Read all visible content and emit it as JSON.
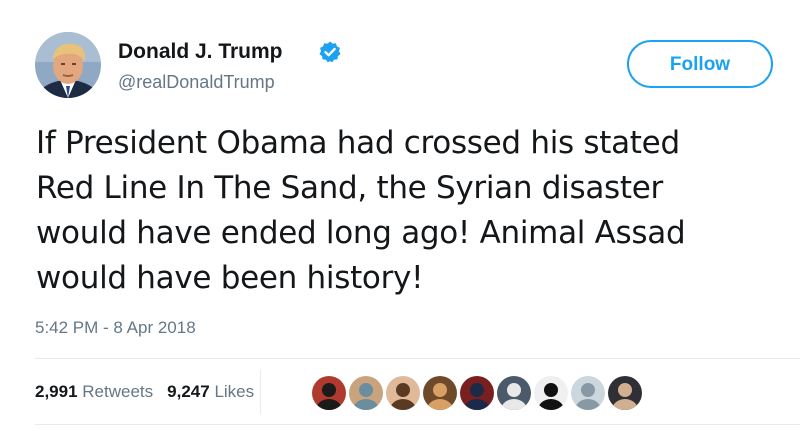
{
  "author": {
    "display_name": "Donald J. Trump",
    "handle": "@realDonaldTrump",
    "verified": true,
    "avatar_icon": "profile-photo"
  },
  "follow_button": {
    "label": "Follow",
    "color": "#1da1f2"
  },
  "tweet": {
    "lines": [
      "If President Obama had crossed his stated",
      "Red Line In The Sand, the Syrian disaster",
      "would have ended long ago! Animal Assad",
      "would have been history!"
    ],
    "timestamp": "5:42 PM - 8 Apr 2018"
  },
  "stats": {
    "retweets": {
      "count": "2,991",
      "label": "Retweets"
    },
    "likes": {
      "count": "9,247",
      "label": "Likes"
    }
  },
  "likers": [
    {
      "name": "liker-avatar-1",
      "color": "#b03a2e",
      "accent": "#1b1b1b"
    },
    {
      "name": "liker-avatar-2",
      "color": "#c9a27e",
      "accent": "#6b8e9f"
    },
    {
      "name": "liker-avatar-3",
      "color": "#e0b89a",
      "accent": "#5a3a22"
    },
    {
      "name": "liker-avatar-4",
      "color": "#6e4a2a",
      "accent": "#d9a066"
    },
    {
      "name": "liker-avatar-5",
      "color": "#7a1f1f",
      "accent": "#1c2a4a"
    },
    {
      "name": "liker-avatar-6",
      "color": "#4a5a6a",
      "accent": "#e8e8e8"
    },
    {
      "name": "liker-avatar-7",
      "color": "#f0f0f0",
      "accent": "#111111"
    },
    {
      "name": "liker-avatar-8",
      "color": "#ccd6dd",
      "accent": "#8899a6"
    },
    {
      "name": "liker-avatar-9",
      "color": "#2f2f35",
      "accent": "#d0b090"
    }
  ]
}
